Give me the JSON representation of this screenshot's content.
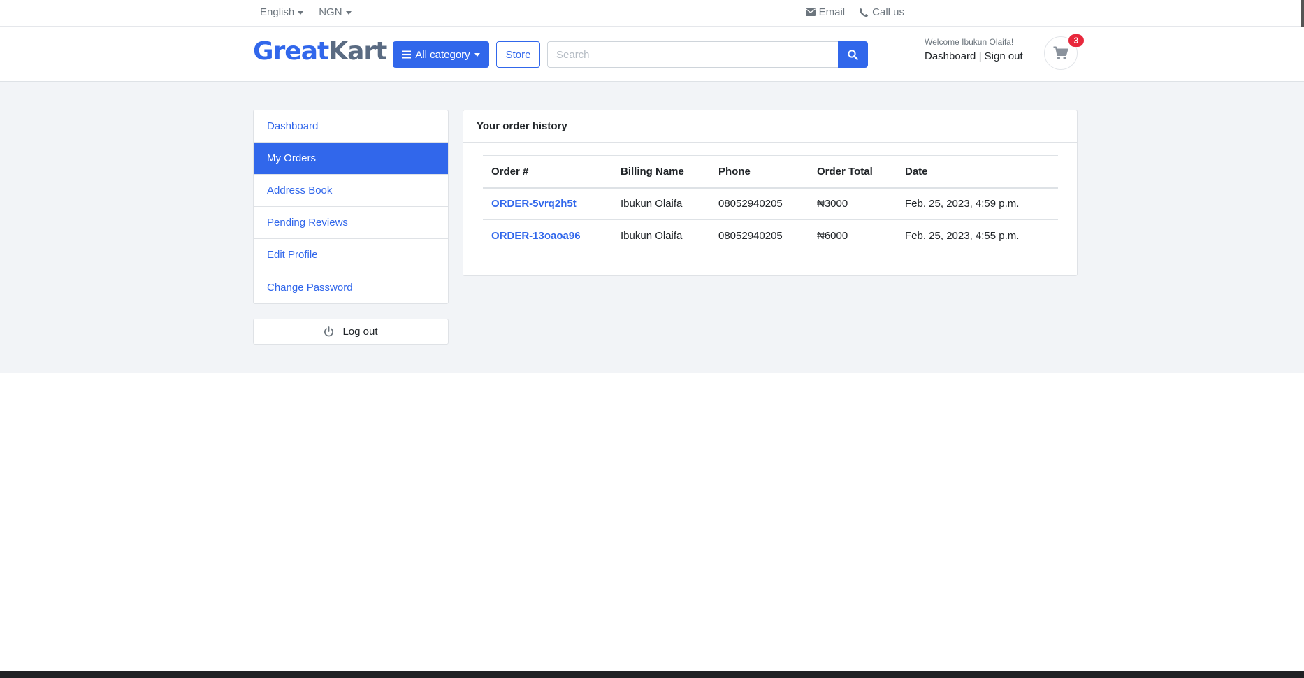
{
  "topbar": {
    "language": "English",
    "currency": "NGN",
    "email_label": "Email",
    "call_label": "Call us"
  },
  "header": {
    "brand_part1": "Great",
    "brand_part2": "Kart",
    "category_button": "All category",
    "store_button": "Store",
    "search_placeholder": "Search",
    "welcome_text": "Welcome Ibukun Olaifa!",
    "dashboard_link": "Dashboard",
    "separator": "|",
    "signout_link": "Sign out",
    "cart_count": "3"
  },
  "sidebar": {
    "items": [
      {
        "label": "Dashboard"
      },
      {
        "label": "My Orders"
      },
      {
        "label": "Address Book"
      },
      {
        "label": "Pending Reviews"
      },
      {
        "label": "Edit Profile"
      },
      {
        "label": "Change Password"
      }
    ],
    "logout_label": "Log out"
  },
  "orders": {
    "title": "Your order history",
    "columns": [
      "Order #",
      "Billing Name",
      "Phone",
      "Order Total",
      "Date"
    ],
    "rows": [
      {
        "order": "ORDER-5vrq2h5t",
        "name": "Ibukun Olaifa",
        "phone": "08052940205",
        "total": "₦3000",
        "date": "Feb. 25, 2023, 4:59 p.m."
      },
      {
        "order": "ORDER-13oaoa96",
        "name": "Ibukun Olaifa",
        "phone": "08052940205",
        "total": "₦6000",
        "date": "Feb. 25, 2023, 4:55 p.m."
      }
    ]
  },
  "colors": {
    "accent": "#3167eb",
    "badge": "#e8283c",
    "section_bg": "#f2f4f7"
  },
  "icons": {
    "email": "envelope-icon",
    "call": "phone-icon",
    "category": "bars-icon",
    "search": "search-icon",
    "cart": "shopping-cart-icon",
    "logout": "power-icon"
  }
}
